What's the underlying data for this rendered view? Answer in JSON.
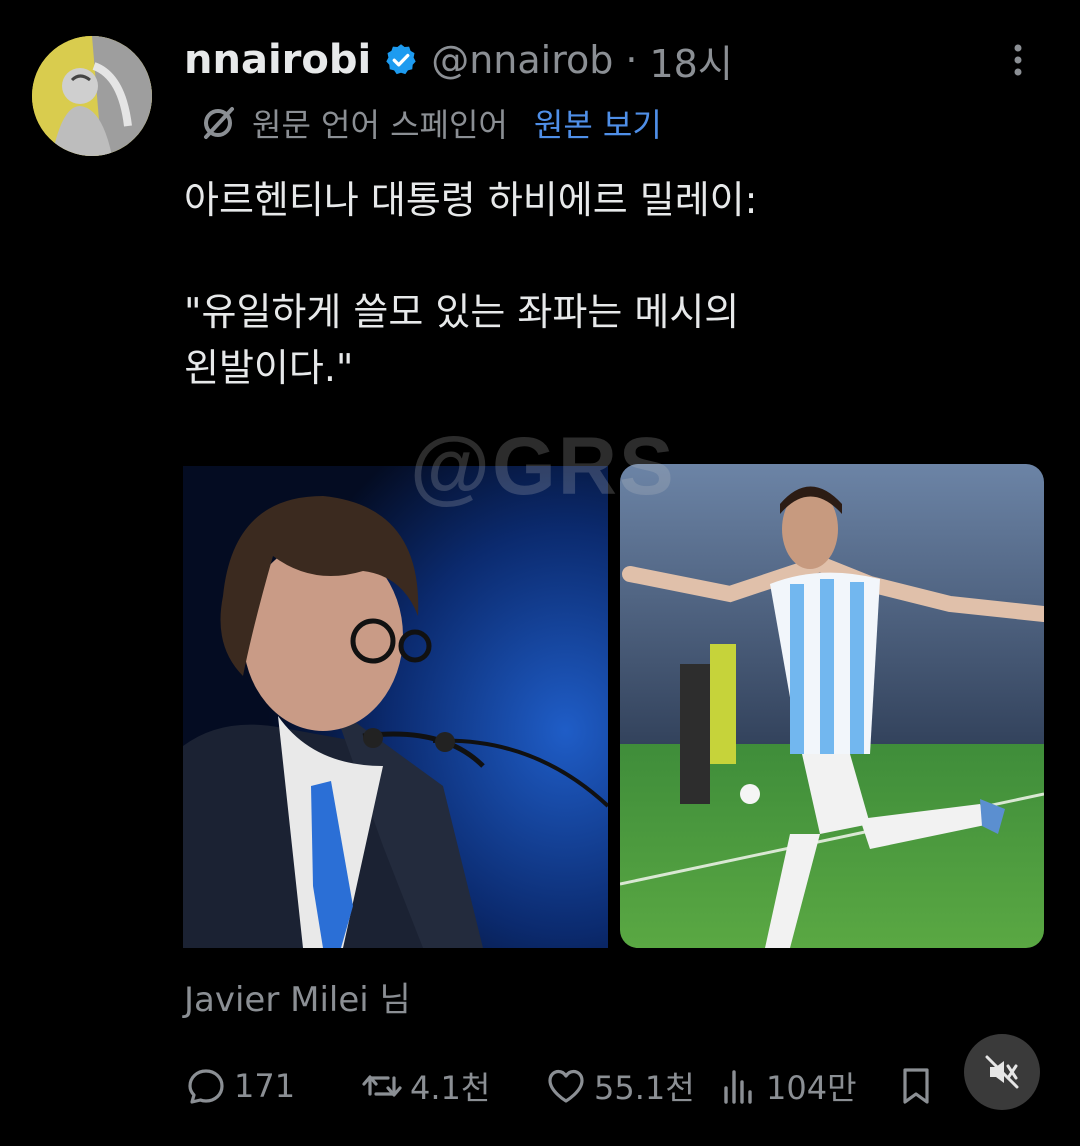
{
  "post": {
    "display_name": "nnairobi",
    "verified": true,
    "handle": "@nnairob",
    "separator": "·",
    "time": "18시",
    "translation": {
      "label": "원문 언어 스페인어",
      "link": "원본 보기"
    },
    "text": "아르헨티나 대통령 하비에르 밀레이:\n\n\"유일하게 쓸모 있는 좌파는 메시의\n왼발이다.\"",
    "watermark": "@GRS",
    "caption": "Javier Milei 님"
  },
  "actions": {
    "replies": "171",
    "reposts": "4.1천",
    "likes": "55.1천",
    "views": "104만"
  },
  "colors": {
    "background": "#000000",
    "text": "#e7e9ea",
    "muted": "#8b8f94",
    "link": "#4f8fe8",
    "verified": "#1d9bf0"
  },
  "icons": {
    "more": "more-vertical-icon",
    "verified": "verified-badge-icon",
    "translate": "translate-icon",
    "reply": "reply-icon",
    "repost": "repost-icon",
    "like": "heart-icon",
    "views": "views-chart-icon",
    "bookmark": "bookmark-icon",
    "mute": "sound-muted-icon"
  }
}
